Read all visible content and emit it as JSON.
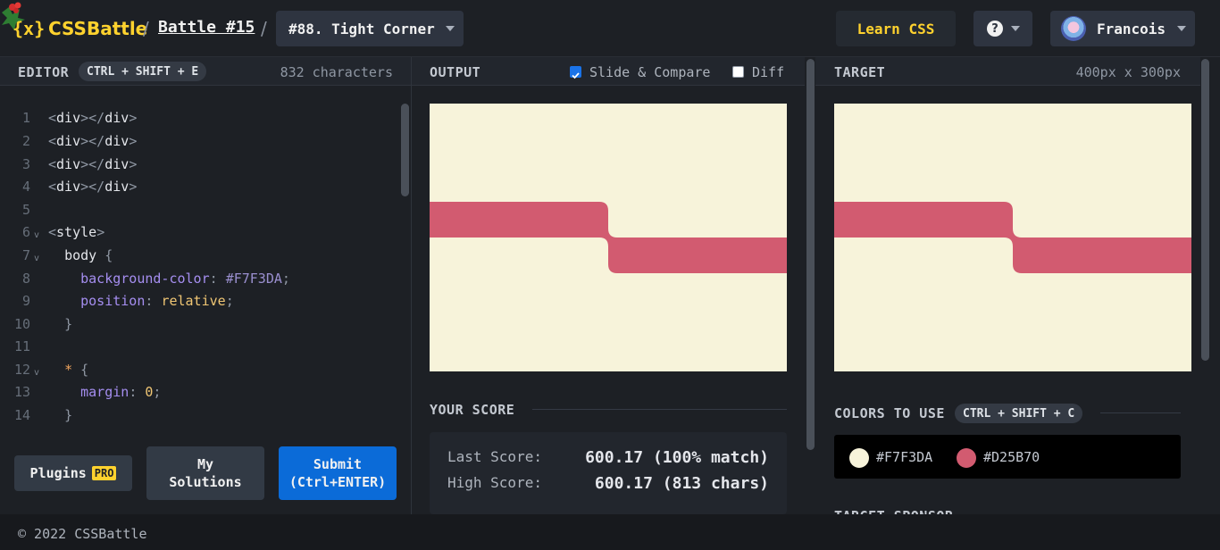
{
  "header": {
    "logo_text": "CSSBattle",
    "logo_mark": "{x}",
    "separator": "/",
    "battle_link": "Battle #15",
    "target_select": "#88. Tight Corner",
    "learn_css": "Learn CSS",
    "help_symbol": "?",
    "username": "Francois"
  },
  "editor": {
    "title": "EDITOR",
    "shortcut": "CTRL + SHIFT + E",
    "char_count": "832 characters",
    "lines": [
      {
        "n": "1",
        "text": "<div></div>"
      },
      {
        "n": "2",
        "text": "<div></div>"
      },
      {
        "n": "3",
        "text": "<div></div>"
      },
      {
        "n": "4",
        "text": "<div></div>"
      },
      {
        "n": "5",
        "text": ""
      },
      {
        "n": "6",
        "text": "<style>"
      },
      {
        "n": "7",
        "text": "  body {"
      },
      {
        "n": "8",
        "text": "    background-color: #F7F3DA;"
      },
      {
        "n": "9",
        "text": "    position: relative;"
      },
      {
        "n": "10",
        "text": "  }"
      },
      {
        "n": "11",
        "text": ""
      },
      {
        "n": "12",
        "text": "  * {"
      },
      {
        "n": "13",
        "text": "    margin: 0;"
      },
      {
        "n": "14",
        "text": "  }"
      }
    ],
    "plugins_label": "Plugins",
    "pro_badge": "PRO",
    "my_solutions_line1": "My",
    "my_solutions_line2": "Solutions",
    "submit_line1": "Submit",
    "submit_line2": "(Ctrl+ENTER)"
  },
  "output": {
    "title": "OUTPUT",
    "slide_compare_label": "Slide & Compare",
    "slide_compare_checked": true,
    "diff_label": "Diff",
    "diff_checked": false
  },
  "score": {
    "title": "YOUR SCORE",
    "last_label": "Last Score:",
    "last_value": "600.17 (100% match)",
    "high_label": "High Score:",
    "high_value": "600.17 (813 chars)"
  },
  "target": {
    "title": "TARGET",
    "size": "400px x 300px",
    "colors_title": "COLORS TO USE",
    "colors_shortcut": "CTRL + SHIFT + C",
    "colors": [
      {
        "hex": "#F7F3DA",
        "label": "#F7F3DA"
      },
      {
        "hex": "#D25B70",
        "label": "#D25B70"
      }
    ],
    "sponsor_title": "TARGET SPONSOR"
  },
  "palette": {
    "background": "#F7F3DA",
    "shape": "#D25B70",
    "accent_yellow": "#ffd22e",
    "submit_blue": "#0b6bd8"
  },
  "footer": {
    "copyright": "© 2022 CSSBattle"
  }
}
